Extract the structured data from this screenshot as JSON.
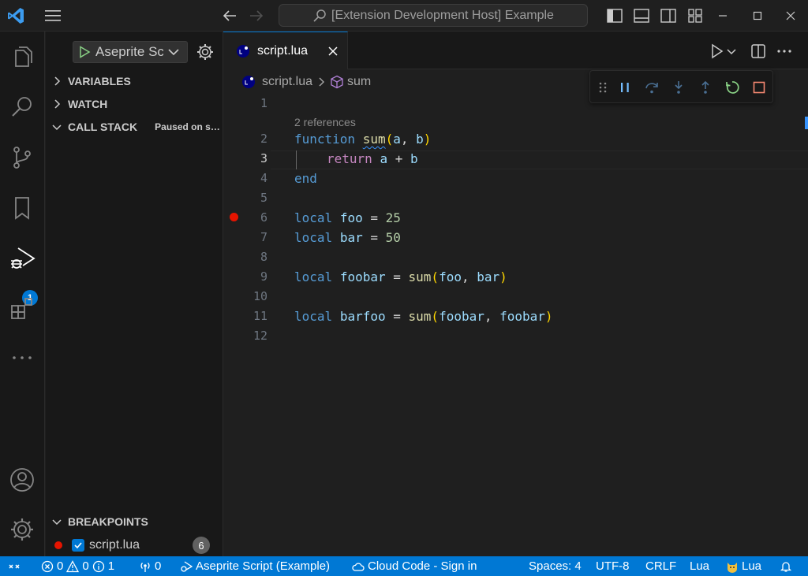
{
  "titlebar": {
    "search_text": "[Extension Development Host] Example"
  },
  "activity_bar": {
    "items": [
      "explorer-icon",
      "search-icon",
      "source-control-icon",
      "bookmark-icon",
      "run-debug-icon",
      "extensions-icon",
      "more-icon"
    ],
    "debug_badge": "1",
    "bottom": [
      "account-icon",
      "settings-gear-icon"
    ]
  },
  "sidebar": {
    "run_config": "Aseprite Script (Example)",
    "sections": {
      "variables": "VARIABLES",
      "watch": "WATCH",
      "call_stack": "CALL STACK",
      "call_stack_status": "Paused on step",
      "breakpoints": "BREAKPOINTS"
    },
    "breakpoint_item": {
      "label": "script.lua",
      "count": "6"
    }
  },
  "editor": {
    "tab_label": "script.lua",
    "breadcrumb": {
      "file": "script.lua",
      "symbol": "sum"
    },
    "references": "2 references",
    "line_numbers": [
      "1",
      "2",
      "3",
      "4",
      "5",
      "6",
      "7",
      "8",
      "9",
      "10",
      "11",
      "12"
    ],
    "active_line": "3",
    "breakpoint_line": "6",
    "code": {
      "l2": [
        "function",
        "sum",
        "(",
        "a",
        ", ",
        "b",
        ")"
      ],
      "l3": [
        "return",
        "a",
        " + ",
        "b"
      ],
      "l4": [
        "end"
      ],
      "l6": [
        "local",
        "foo",
        " = ",
        "25"
      ],
      "l7": [
        "local",
        "bar",
        " = ",
        "50"
      ],
      "l9": [
        "local",
        "foobar",
        " = ",
        "sum",
        "(",
        "foo",
        ", ",
        "bar",
        ")"
      ],
      "l11": [
        "local",
        "barfoo",
        " = ",
        "sum",
        "(",
        "foobar",
        ", ",
        "foobar",
        ")"
      ]
    }
  },
  "debug_toolbar": [
    "pause-icon",
    "step-over-icon",
    "step-into-icon",
    "step-out-icon",
    "restart-icon",
    "stop-icon"
  ],
  "statusbar": {
    "errors": "0",
    "warnings": "0",
    "info": "1",
    "ports": "0",
    "debug_config": "Aseprite Script (Example)",
    "cloud": "Cloud Code - Sign in",
    "spaces": "Spaces: 4",
    "encoding": "UTF-8",
    "eol": "CRLF",
    "language": "Lua",
    "language_server": "Lua"
  },
  "colors": {
    "accent": "#0078d4",
    "breakpoint": "#e51400",
    "keyword": "#569cd6",
    "control_keyword": "#c586c0",
    "function": "#dcdcaa",
    "variable": "#9cdcfe",
    "number": "#b5cea8"
  }
}
